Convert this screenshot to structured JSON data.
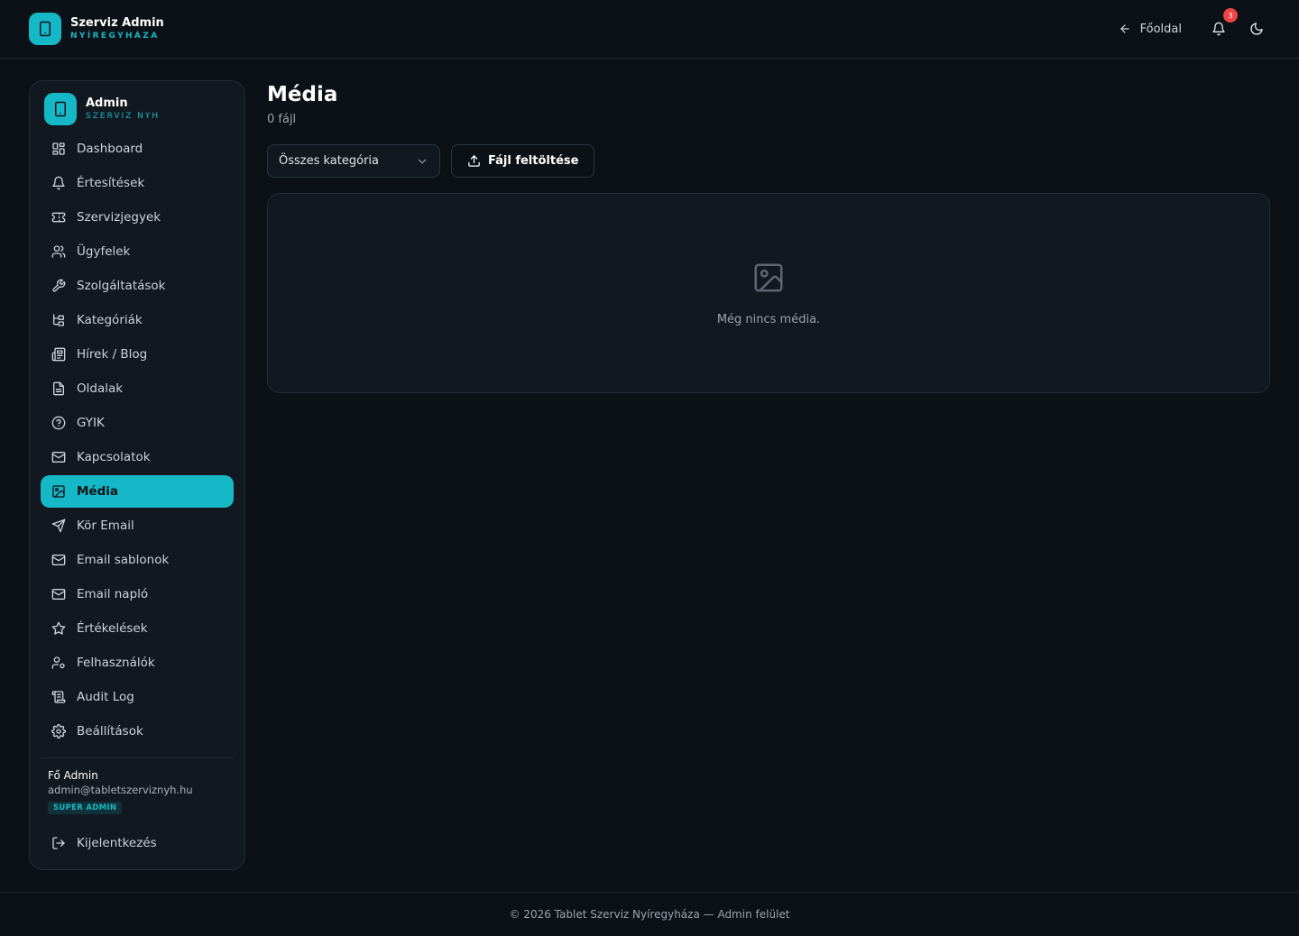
{
  "header": {
    "brand_title": "Szerviz Admin",
    "brand_subtitle": "NYÍREGYHÁZA",
    "home_label": "Főoldal",
    "notification_count": "3"
  },
  "sidebar": {
    "title": "Admin",
    "subtitle": "SZERVIZ NYH",
    "items": [
      {
        "label": "Dashboard",
        "icon": "grid-icon"
      },
      {
        "label": "Értesítések",
        "icon": "bell-icon"
      },
      {
        "label": "Szervizjegyek",
        "icon": "ticket-icon"
      },
      {
        "label": "Ügyfelek",
        "icon": "users-icon"
      },
      {
        "label": "Szolgáltatások",
        "icon": "wrench-icon"
      },
      {
        "label": "Kategóriák",
        "icon": "tree-icon"
      },
      {
        "label": "Hírek / Blog",
        "icon": "newspaper-icon"
      },
      {
        "label": "Oldalak",
        "icon": "file-icon"
      },
      {
        "label": "GYIK",
        "icon": "help-circle-icon"
      },
      {
        "label": "Kapcsolatok",
        "icon": "mail-icon"
      },
      {
        "label": "Média",
        "icon": "image-icon",
        "active": true
      },
      {
        "label": "Kör Email",
        "icon": "send-icon"
      },
      {
        "label": "Email sablonok",
        "icon": "mail-icon"
      },
      {
        "label": "Email napló",
        "icon": "mail-icon"
      },
      {
        "label": "Értékelések",
        "icon": "star-icon"
      },
      {
        "label": "Felhasználók",
        "icon": "user-cog-icon"
      },
      {
        "label": "Audit Log",
        "icon": "scroll-icon"
      },
      {
        "label": "Beállítások",
        "icon": "gear-icon"
      }
    ],
    "user": {
      "name": "Fő Admin",
      "email": "admin@tabletszerviznyh.hu",
      "role": "SUPER ADMIN"
    },
    "logout_label": "Kijelentkezés"
  },
  "main": {
    "title": "Média",
    "subtitle": "0 fájl",
    "category_select": "Összes kategória",
    "upload_label": "Fájl feltöltése",
    "empty_text": "Még nincs média."
  },
  "footer": {
    "text": "© 2026 Tablet Szerviz Nyíregyháza — Admin felület"
  },
  "colors": {
    "accent": "#15b8c6",
    "background": "#0c1117",
    "card": "#111820",
    "badge": "#ef4444"
  }
}
